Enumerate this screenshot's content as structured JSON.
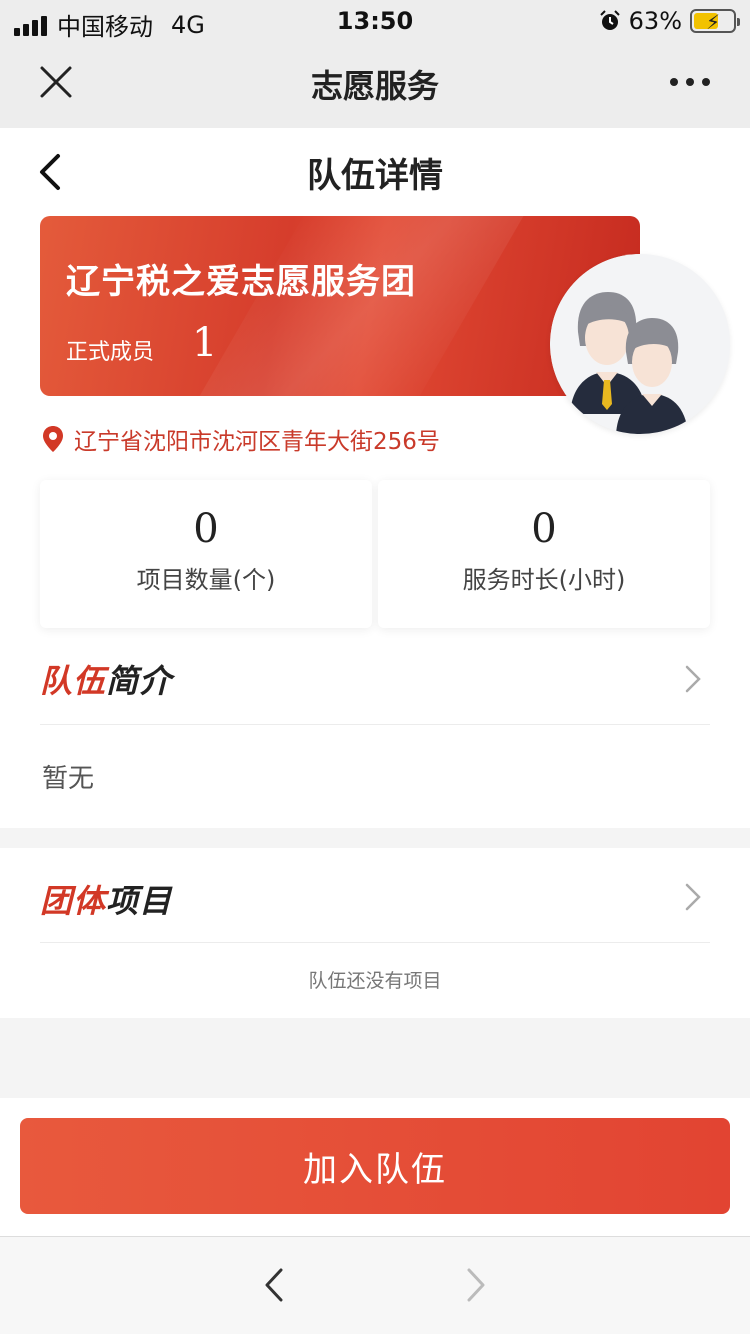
{
  "status_bar": {
    "carrier": "中国移动",
    "network": "4G",
    "time": "13:50",
    "battery": "63%",
    "battery_level": 0.63
  },
  "app_nav": {
    "title": "志愿服务"
  },
  "page": {
    "title": "队伍详情"
  },
  "team": {
    "name": "辽宁税之爱志愿服务团",
    "member_label": "正式成员",
    "member_count": "1",
    "address": "辽宁省沈阳市沈河区青年大街256号"
  },
  "stats": {
    "projects_value": "0",
    "projects_label": "项目数量(个)",
    "hours_value": "0",
    "hours_label": "服务时长(小时)"
  },
  "intro": {
    "title_red": "队伍",
    "title_dark": "简介",
    "content": "暂无"
  },
  "projects": {
    "title_red": "团体",
    "title_dark": "项目",
    "empty": "队伍还没有项目"
  },
  "actions": {
    "join_label": "加入队伍"
  },
  "colors": {
    "brand_red": "#d23826",
    "address_red": "#c93a2a",
    "battery_yellow": "#f2c200"
  }
}
